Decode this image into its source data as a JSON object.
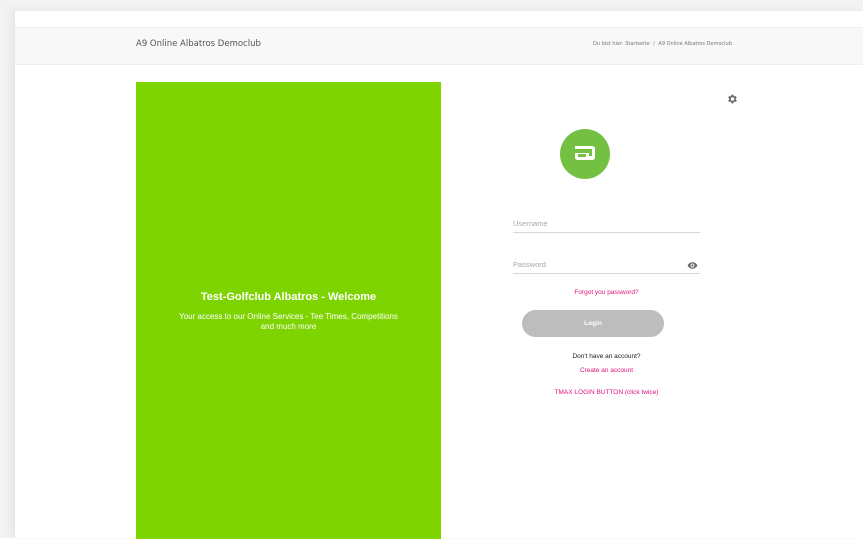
{
  "header": {
    "site_title": "A9 Online Albatros Democlub",
    "breadcrumb": {
      "prefix": "Du bist hier:",
      "items": [
        "Startseite",
        "A9 Online Albatros Democlub"
      ],
      "separator": "/"
    }
  },
  "welcome_panel": {
    "title": "Test-Golfclub Albatros - Welcome",
    "subtitle": "Your access to our Online Services - Tee Times, Competitions and much more",
    "background_color": "#7ed400"
  },
  "login_form": {
    "username_placeholder": "Username",
    "password_placeholder": "Password",
    "forgot_password": "Forgot you password?",
    "login_button": "Login",
    "no_account_text": "Don't have an account?",
    "create_account": "Create an account",
    "tmax_button": "TMAX LOGIN BUTTON (click twice)",
    "link_color": "#e0117a",
    "logo_color": "#74c043"
  },
  "icons": {
    "settings": "gear-icon",
    "show_password": "eye-icon",
    "club_logo": "albatros-logo-icon"
  }
}
